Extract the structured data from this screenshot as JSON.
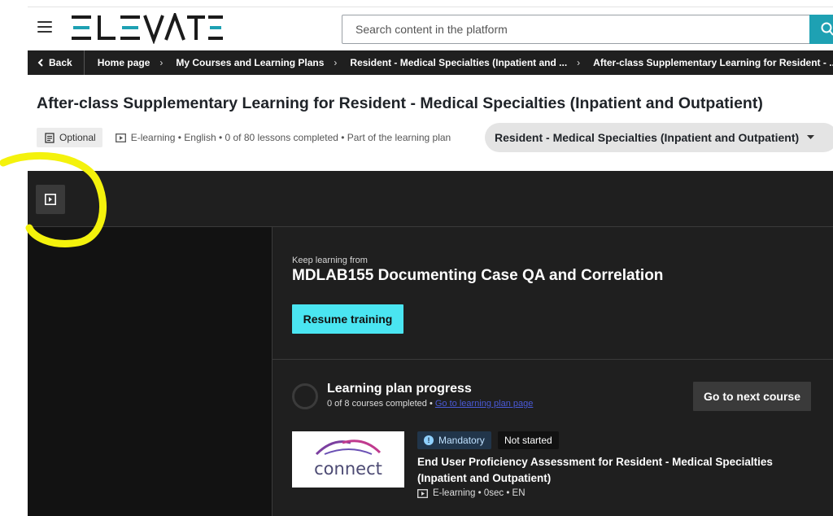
{
  "header": {
    "brand": "ELEVATE",
    "search_placeholder": "Search content in the platform"
  },
  "breadcrumb": {
    "back_label": "Back",
    "items": [
      "Home page",
      "My Courses and Learning Plans",
      "Resident - Medical Specialties (Inpatient and ...",
      "After-class Supplementary Learning for Resident - ..."
    ]
  },
  "course_header": {
    "title": "After-class Supplementary Learning for Resident - Medical Specialties (Inpatient and Outpatient)",
    "optional_label": "Optional",
    "meta_text": "E-learning • English • 0 of 80 lessons completed • Part of the learning plan",
    "learning_plan": "Resident - Medical Specialties (Inpatient and Outpatient)"
  },
  "resume_panel": {
    "keep_learning_label": "Keep learning from",
    "course_name": "MDLAB155 Documenting Case QA and Correlation",
    "resume_button": "Resume training"
  },
  "plan_progress": {
    "title": "Learning plan progress",
    "summary": "0 of 8 courses completed •",
    "link_text": "Go to learning plan page",
    "next_button": "Go to next course",
    "progress_fraction": 0
  },
  "next_item": {
    "thumbnail_text": "connect",
    "badge_mandatory": "Mandatory",
    "badge_status": "Not started",
    "title": "End User Proficiency Assessment for Resident - Medical Specialties (Inpatient and Outpatient)",
    "meta": "E-learning • 0sec • EN"
  },
  "colors": {
    "brand_teal": "#1ea1b3",
    "accent_cyan": "#4ae5f1",
    "dark_bg": "#1f1f1f",
    "highlight_yellow": "#f4f20c"
  }
}
